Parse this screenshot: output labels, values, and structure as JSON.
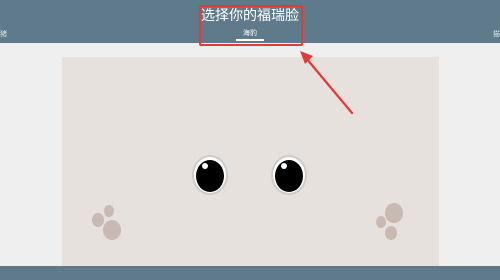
{
  "header": {
    "title": "选择你的福瑞脸",
    "active_tab": "海豹",
    "left_edge_text": "猪",
    "right_edge_text": "猫"
  },
  "colors": {
    "header_bg": "#5f7a8b",
    "page_bg": "#efefef",
    "canvas_bg": "#e6e1dd",
    "highlight": "#e53935",
    "paw": "#c8bab2"
  },
  "icons": {
    "eyes": "seal-eye-icon",
    "paws": "paw-print-icon",
    "annotation": "arrow-annotation-icon"
  }
}
